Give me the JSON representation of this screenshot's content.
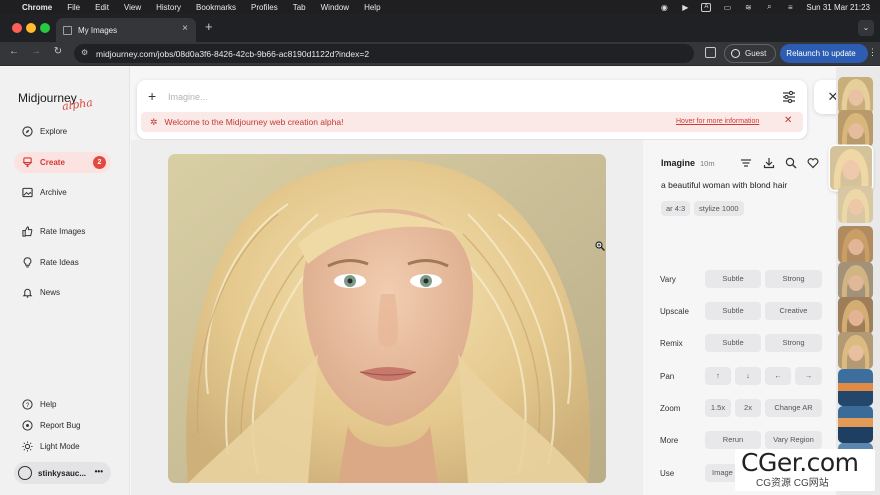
{
  "menubar": {
    "apple": "",
    "items": [
      "Chrome",
      "File",
      "Edit",
      "View",
      "History",
      "Bookmarks",
      "Profiles",
      "Tab",
      "Window",
      "Help"
    ],
    "datetime": "Sun 31 Mar  21:23",
    "input_indicator": "A"
  },
  "browser": {
    "tab_title": "My Images",
    "url": "midjourney.com/jobs/08d0a3f6-8426-42cb-9b66-ac8190d1122d?index=2",
    "profile_label": "Guest",
    "relaunch_label": "Relaunch to update"
  },
  "sidebar": {
    "logo": "Midjourney",
    "logo_tag": "alpha",
    "items": [
      {
        "label": "Explore",
        "icon": "compass-icon"
      },
      {
        "label": "Create",
        "icon": "brush-icon",
        "badge": "2",
        "active": true
      },
      {
        "label": "Archive",
        "icon": "image-icon"
      },
      {
        "label": "Rate Images",
        "icon": "thumbs-up-icon"
      },
      {
        "label": "Rate Ideas",
        "icon": "lightbulb-icon"
      },
      {
        "label": "News",
        "icon": "bell-icon"
      }
    ],
    "bottom": [
      {
        "label": "Help",
        "icon": "question-icon"
      },
      {
        "label": "Report Bug",
        "icon": "bug-icon"
      },
      {
        "label": "Light Mode",
        "icon": "sun-icon"
      }
    ],
    "user": "stinkysauc..."
  },
  "prompt": {
    "placeholder": "Imagine...",
    "banner_text": "Welcome to the Midjourney web creation alpha!",
    "banner_link": "Hover for more information"
  },
  "details": {
    "title": "Imagine",
    "time": "10m",
    "prompt_text": "a beautiful woman with blond hair",
    "tags": [
      "ar 4:3",
      "stylize 1000"
    ],
    "rows": [
      {
        "label": "Vary",
        "buttons": [
          "Subtle",
          "Strong"
        ]
      },
      {
        "label": "Upscale",
        "buttons": [
          "Subtle",
          "Creative"
        ]
      },
      {
        "label": "Remix",
        "buttons": [
          "Subtle",
          "Strong"
        ]
      },
      {
        "label": "Pan",
        "buttons": [
          "↑",
          "↓",
          "←",
          "→"
        ]
      },
      {
        "label": "Zoom",
        "buttons": [
          "1.5x",
          "2x",
          "Change AR"
        ]
      },
      {
        "label": "More",
        "buttons": [
          "Rerun",
          "Vary Region"
        ]
      },
      {
        "label": "Use",
        "buttons": [
          "Image"
        ]
      }
    ]
  },
  "watermark": {
    "main": "CGer.com",
    "sub": "CG资源 CG网站"
  },
  "colors": {
    "accent": "#d13a33",
    "badge": "#e24a41",
    "relaunch": "#2c5db3"
  }
}
